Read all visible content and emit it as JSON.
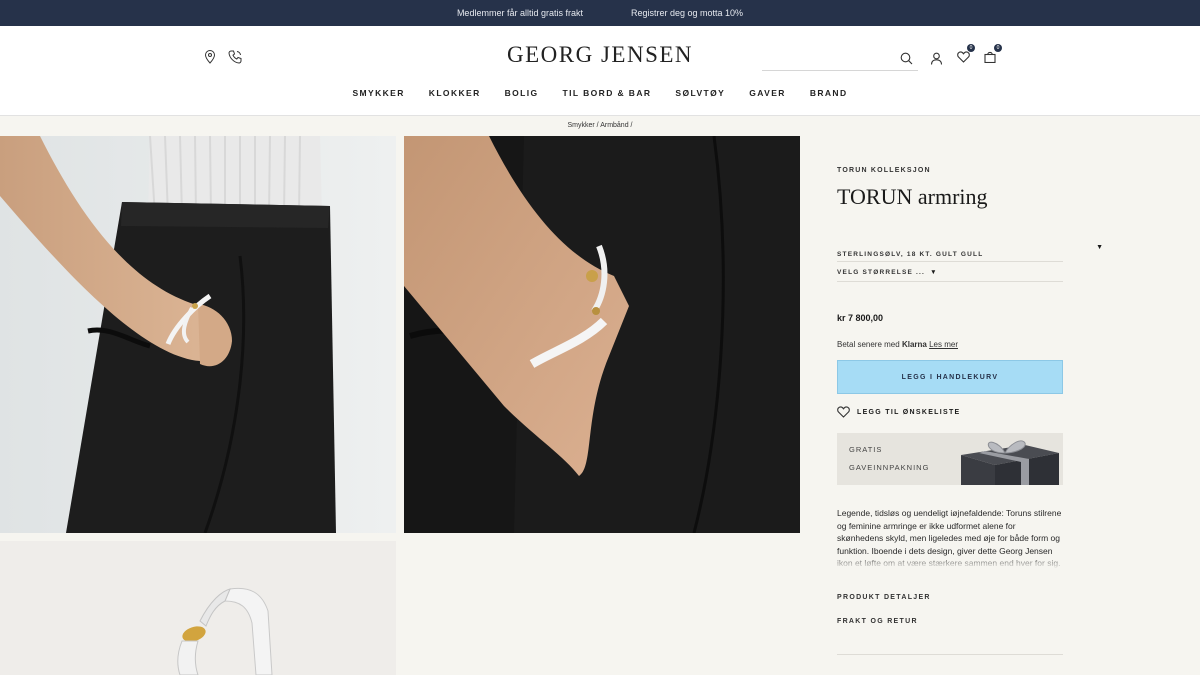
{
  "topbar": {
    "message_1": "Medlemmer får alltid gratis frakt",
    "message_2": "Registrer deg og motta 10%"
  },
  "header": {
    "logo": "GEORG JENSEN",
    "wishlist_count": "0",
    "cart_count": "0",
    "icons": [
      "location-icon",
      "phone-icon",
      "search-icon",
      "account-icon",
      "wishlist-icon",
      "cart-icon"
    ]
  },
  "nav": {
    "items": [
      "SMYKKER",
      "KLOKKER",
      "BOLIG",
      "TIL BORD & BAR",
      "SØLVTØY",
      "GAVER",
      "BRAND"
    ]
  },
  "breadcrumb": {
    "level_1": "Smykker",
    "level_2": "Armbånd"
  },
  "product": {
    "collection": "TORUN KOLLEKSJON",
    "title": "TORUN armring",
    "material": "STERLINGSØLV, 18 KT. GULT GULL",
    "size_label": "VELG STØRRELSE ...",
    "price": "kr 7 800,00",
    "klarna_prefix": "Betal senere med",
    "klarna_brand": "Klarna",
    "klarna_link": "Les mer",
    "add_to_cart": "LEGG I HANDLEKURV",
    "wishlist": "LEGG TIL ØNSKELISTE",
    "gift_line_1": "GRATIS",
    "gift_line_2": "GAVEINNPAKNING",
    "description": "Legende, tidsløs og uendeligt iøjnefaldende: Toruns stilrene og feminine armringe er ikke udformet alene for skønhedens skyld, men ligeledes med øje for både form og funktion. Iboende i dets design, giver dette Georg Jensen ikon et løfte om at være stærkere sammen end hver for sig.",
    "details": "PRODUKT DETALJER",
    "shipping": "FRAKT OG RETUR"
  },
  "colors": {
    "topbar": "#26324a",
    "cta": "#a6dcf5",
    "page_bg": "#f6f5f0"
  }
}
